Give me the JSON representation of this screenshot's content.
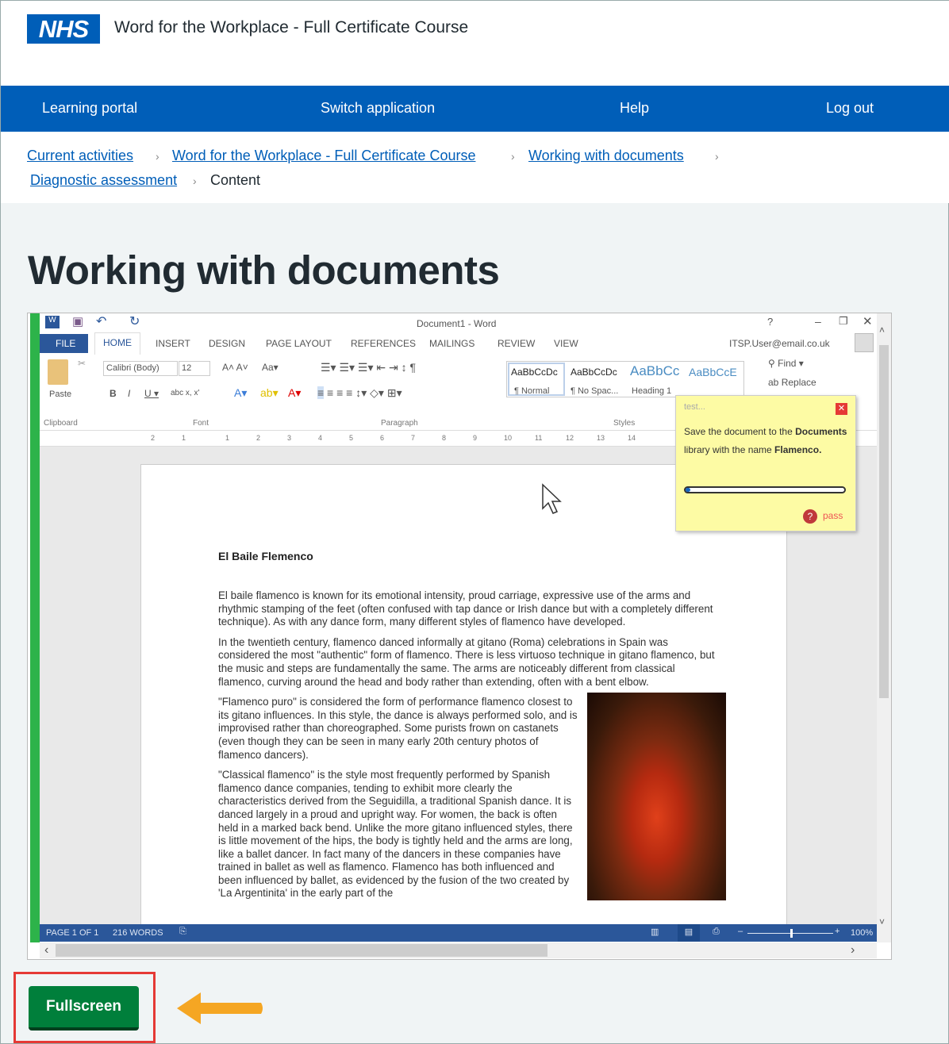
{
  "header": {
    "logo": "NHS",
    "title": "Word for the Workplace - Full Certificate Course"
  },
  "nav": {
    "items": [
      "Learning portal",
      "Switch application",
      "Help",
      "Log out"
    ]
  },
  "breadcrumb": {
    "links": [
      "Current activities",
      "Word for the Workplace - Full Certificate Course",
      "Working with documents",
      "Diagnostic assessment"
    ],
    "current": "Content"
  },
  "page_title": "Working with documents",
  "word": {
    "window_title": "Document1 - Word",
    "tabs": [
      "FILE",
      "HOME",
      "INSERT",
      "DESIGN",
      "PAGE LAYOUT",
      "REFERENCES",
      "MAILINGS",
      "REVIEW",
      "VIEW"
    ],
    "user": "ITSP.User@email.co.uk",
    "font_name": "Calibri (Body)",
    "font_size": "12",
    "paste": "Paste",
    "styles": [
      {
        "sample": "AaBbCcDc",
        "name": "¶ Normal"
      },
      {
        "sample": "AaBbCcDc",
        "name": "¶ No Spac..."
      },
      {
        "sample": "AaBbCc",
        "name": "Heading 1"
      },
      {
        "sample": "AaBbCcE",
        "name": ""
      }
    ],
    "find": "Find",
    "replace": "Replace",
    "groups": [
      "Clipboard",
      "Font",
      "Paragraph",
      "Styles"
    ],
    "ruler": [
      "2",
      "1",
      "1",
      "2",
      "3",
      "4",
      "5",
      "6",
      "7",
      "8",
      "9",
      "10",
      "11",
      "12",
      "13",
      "14"
    ],
    "doc_title": "El Baile Flemenco",
    "paragraphs": [
      "El baile flamenco is known for its emotional intensity, proud carriage, expressive use of the arms and rhythmic stamping of the feet (often confused with tap dance or Irish dance but with a completely different technique). As with any dance form, many different styles of flamenco have developed.",
      "In the twentieth century, flamenco danced informally at gitano (Roma) celebrations in Spain was considered the most \"authentic\" form of flamenco. There is less virtuoso technique in gitano flamenco, but the music and steps are fundamentally the same. The arms are noticeably different from classical flamenco, curving around the head and body rather than extending, often with a bent elbow.",
      "\"Flamenco puro\" is considered the form of performance flamenco closest to its gitano influences. In this style, the dance is always performed solo, and is improvised rather than choreographed. Some purists frown on castanets (even though they can be seen in many early 20th century photos of flamenco dancers).",
      "\"Classical flamenco\" is the style most frequently performed by Spanish flamenco dance companies, tending to exhibit more clearly the characteristics derived from the Seguidilla, a traditional Spanish dance. It is danced largely in a proud and upright way. For women, the back is often held in a marked back bend. Unlike the more gitano influenced styles, there is little movement of the hips, the body is tightly held and the arms are long, like a ballet dancer. In fact many of the dancers in these companies have trained in ballet as well as flamenco. Flamenco has both influenced and been influenced by ballet, as evidenced by the fusion of the two created by 'La Argentinita' in the early part of the"
    ],
    "status": {
      "page": "PAGE 1 OF 1",
      "words": "216 WORDS",
      "zoom": "100%"
    },
    "zoom_percent": 100
  },
  "task": {
    "header": "test...",
    "text_1": "Save the document to the ",
    "bold_1": "Documents",
    "text_2": " library with the name ",
    "bold_2": "Flamenco.",
    "progress_percent": 2,
    "pass": "pass"
  },
  "fullscreen_label": "Fullscreen",
  "colors": {
    "nhs_blue": "#005eb8",
    "word_blue": "#2b579a",
    "button_green": "#007f3b",
    "highlight_red": "#e53935",
    "arrow_orange": "#f5a623"
  }
}
